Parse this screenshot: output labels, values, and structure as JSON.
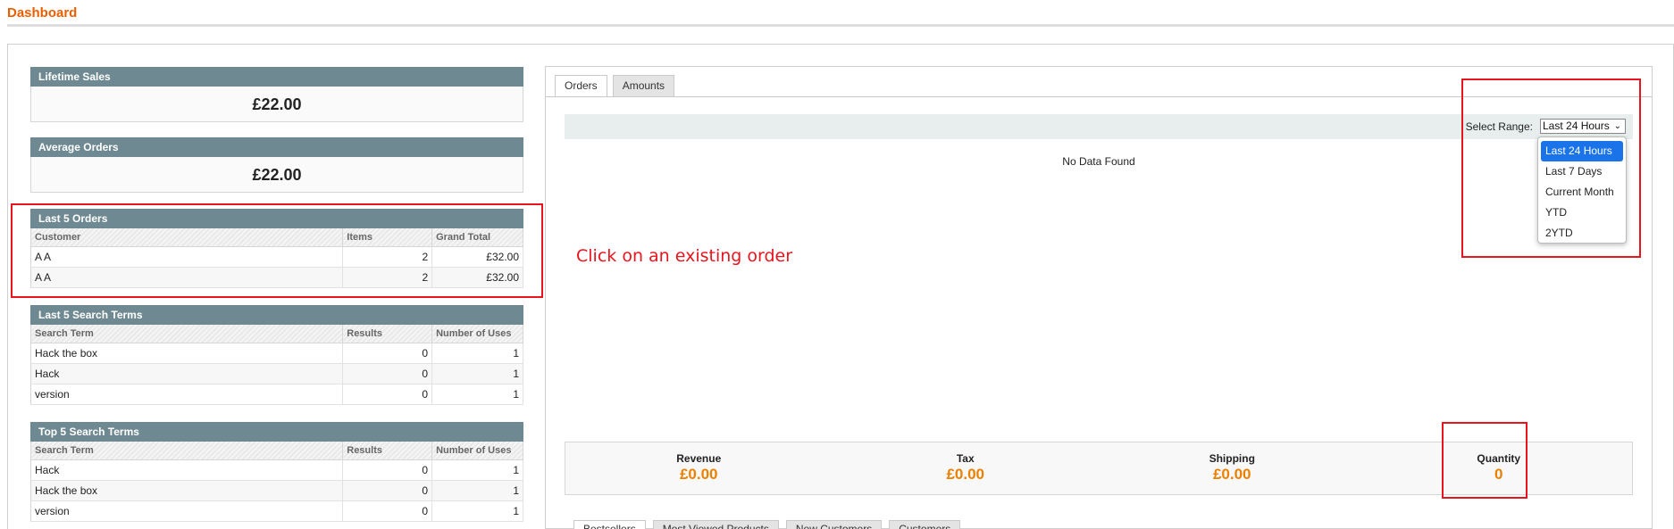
{
  "page": {
    "title": "Dashboard"
  },
  "lifetime_sales": {
    "label": "Lifetime Sales",
    "value": "£22.00"
  },
  "average_orders": {
    "label": "Average Orders",
    "value": "£22.00"
  },
  "last_orders": {
    "label": "Last 5 Orders",
    "columns": [
      "Customer",
      "Items",
      "Grand Total"
    ],
    "rows": [
      {
        "customer": "A A",
        "items": "2",
        "total": "£32.00"
      },
      {
        "customer": "A A",
        "items": "2",
        "total": "£32.00"
      }
    ]
  },
  "last_search": {
    "label": "Last 5 Search Terms",
    "columns": [
      "Search Term",
      "Results",
      "Number of Uses"
    ],
    "rows": [
      {
        "term": "Hack the box",
        "results": "0",
        "uses": "1"
      },
      {
        "term": "Hack",
        "results": "0",
        "uses": "1"
      },
      {
        "term": "version",
        "results": "0",
        "uses": "1"
      }
    ]
  },
  "top_search": {
    "label": "Top 5 Search Terms",
    "columns": [
      "Search Term",
      "Results",
      "Number of Uses"
    ],
    "rows": [
      {
        "term": "Hack",
        "results": "0",
        "uses": "1"
      },
      {
        "term": "Hack the box",
        "results": "0",
        "uses": "1"
      },
      {
        "term": "version",
        "results": "0",
        "uses": "1"
      }
    ]
  },
  "annotation": {
    "text": "Click on an existing order",
    "color": "#e8141e"
  },
  "chart_panel": {
    "tabs": [
      "Orders",
      "Amounts"
    ],
    "range_label": "Select Range:",
    "range_selected": "Last 24 Hours",
    "range_options": [
      "Last 24 Hours",
      "Last 7 Days",
      "Current Month",
      "YTD",
      "2YTD"
    ],
    "no_data": "No Data Found",
    "totals": [
      {
        "label": "Revenue",
        "value": "£0.00"
      },
      {
        "label": "Tax",
        "value": "£0.00"
      },
      {
        "label": "Shipping",
        "value": "£0.00"
      },
      {
        "label": "Quantity",
        "value": "0"
      }
    ]
  },
  "bottom_tabs": [
    "Bestsellers",
    "Most Viewed Products",
    "New Customers",
    "Customers"
  ],
  "colors": {
    "accent": "#eb5e00",
    "header_bg": "#6f8992",
    "value": "#eb8000",
    "selected_option": "#1a73e8"
  }
}
